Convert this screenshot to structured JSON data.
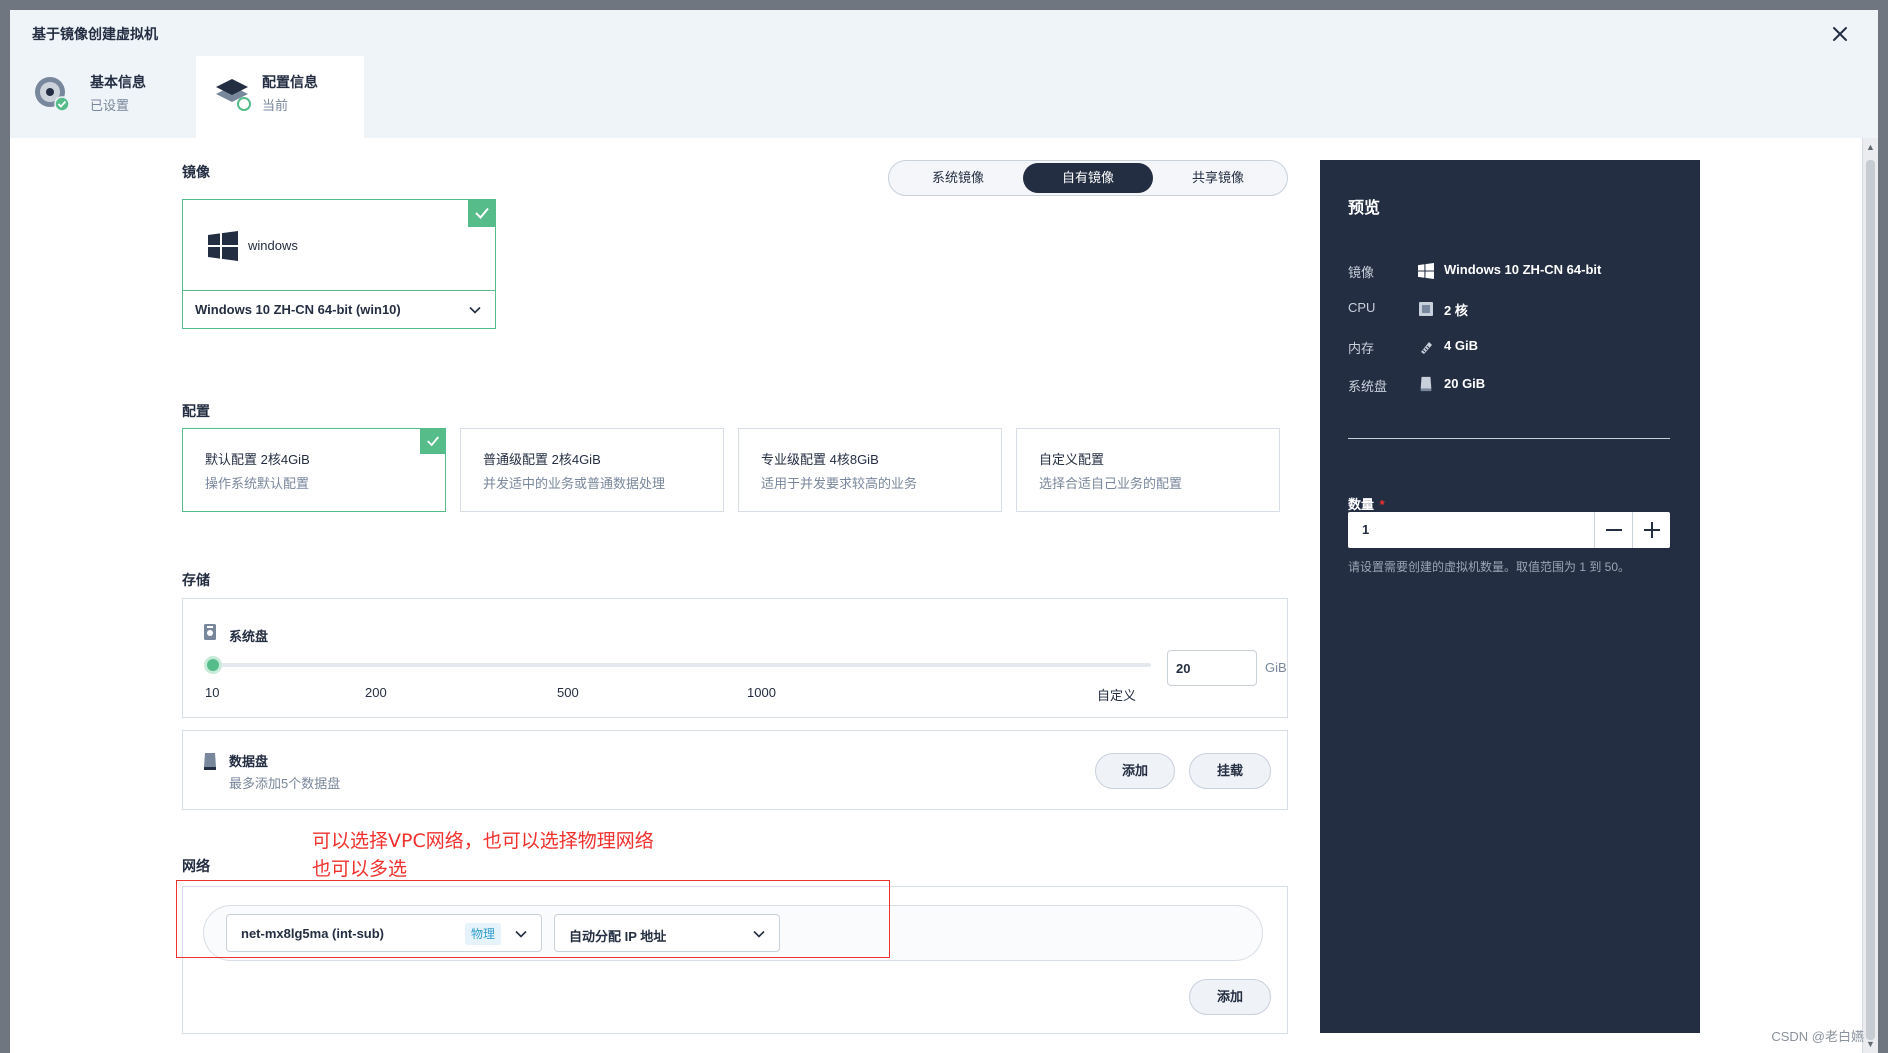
{
  "modal": {
    "title": "基于镜像创建虚拟机",
    "steps": [
      {
        "title": "基本信息",
        "sub": "已设置"
      },
      {
        "title": "配置信息",
        "sub": "当前"
      }
    ]
  },
  "image": {
    "label": "镜像",
    "tabs": [
      "系统镜像",
      "自有镜像",
      "共享镜像"
    ],
    "active_tab": "自有镜像",
    "card_name": "windows",
    "selected_image": "Windows 10 ZH-CN 64-bit (win10)"
  },
  "config": {
    "label": "配置",
    "options": [
      {
        "title": "默认配置 2核4GiB",
        "desc": "操作系统默认配置",
        "selected": true
      },
      {
        "title": "普通级配置 2核4GiB",
        "desc": "并发适中的业务或普通数据处理",
        "selected": false
      },
      {
        "title": "专业级配置 4核8GiB",
        "desc": "适用于并发要求较高的业务",
        "selected": false
      },
      {
        "title": "自定义配置",
        "desc": "选择合适自己业务的配置",
        "selected": false
      }
    ]
  },
  "storage": {
    "label": "存储",
    "system_disk_label": "系统盘",
    "slider_marks": [
      "10",
      "200",
      "500",
      "1000",
      "自定义"
    ],
    "slider_position": 0,
    "size_value": "20",
    "size_unit": "GiB",
    "data_disk_label": "数据盘",
    "data_disk_hint": "最多添加5个数据盘",
    "add_label": "添加",
    "mount_label": "挂载"
  },
  "network": {
    "label": "网络",
    "annotation_line1": "可以选择VPC网络，也可以选择物理网络",
    "annotation_line2": "也可以多选",
    "network_value": "net-mx8lg5ma (int-sub)",
    "network_tag": "物理",
    "ip_value": "自动分配 IP 地址",
    "add_label": "添加"
  },
  "preview": {
    "title": "预览",
    "rows": [
      {
        "label": "镜像",
        "value": "Windows 10 ZH-CN 64-bit",
        "icon": "windows-icon"
      },
      {
        "label": "CPU",
        "value": "2 核",
        "icon": "cpu-icon"
      },
      {
        "label": "内存",
        "value": "4 GiB",
        "icon": "memory-icon"
      },
      {
        "label": "系统盘",
        "value": "20 GiB",
        "icon": "disk-icon"
      }
    ],
    "quantity_label": "数量",
    "required_mark": "*",
    "quantity_value": "1",
    "quantity_hint": "请设置需要创建的虚拟机数量。取值范围为 1 到 50。"
  },
  "watermark": "CSDN @老白嬿",
  "colors": {
    "accent": "#55bc8a",
    "dark": "#242e42",
    "annotation": "#f0312e",
    "tag_blue": "#329dce"
  }
}
